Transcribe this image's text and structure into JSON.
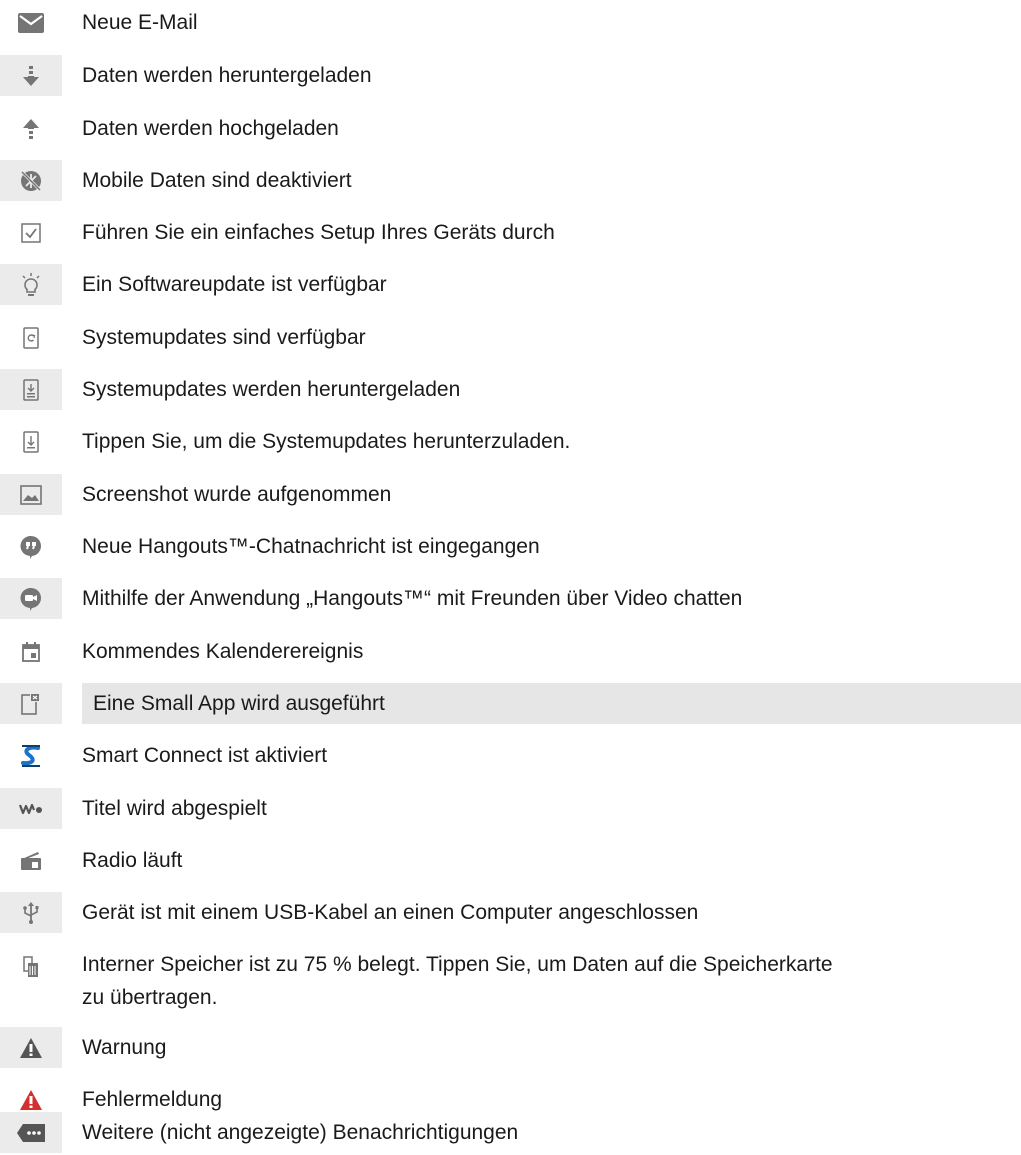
{
  "items": [
    {
      "icon": "envelope-icon",
      "label": "Neue E-Mail"
    },
    {
      "icon": "download-arrow-icon",
      "label": "Daten werden heruntergeladen"
    },
    {
      "icon": "upload-arrow-icon",
      "label": "Daten werden hochgeladen"
    },
    {
      "icon": "mobile-data-disabled-icon",
      "label": "Mobile Daten sind deaktiviert"
    },
    {
      "icon": "checkbox-checked-icon",
      "label": "Führen Sie ein einfaches Setup Ihres Geräts durch"
    },
    {
      "icon": "lightbulb-icon",
      "label": "Ein Softwareupdate ist verfügbar"
    },
    {
      "icon": "system-update-icon",
      "label": "Systemupdates sind verfügbar"
    },
    {
      "icon": "system-update-download-icon",
      "label": "Systemupdates werden heruntergeladen"
    },
    {
      "icon": "tap-download-icon",
      "label": "Tippen Sie, um die Systemupdates herunterzuladen."
    },
    {
      "icon": "screenshot-image-icon",
      "label": "Screenshot wurde aufgenommen"
    },
    {
      "icon": "hangouts-quote-icon",
      "label": "Neue Hangouts™-Chatnachricht ist eingegangen"
    },
    {
      "icon": "hangouts-video-icon",
      "label": "Mithilfe der Anwendung „Hangouts™“ mit Freunden über Video chatten"
    },
    {
      "icon": "calendar-icon",
      "label": "Kommendes Kalenderereignis"
    },
    {
      "icon": "small-app-icon",
      "label": "Eine Small App wird ausgeführt"
    },
    {
      "icon": "smart-connect-icon",
      "label": "Smart Connect ist aktiviert"
    },
    {
      "icon": "walkman-icon",
      "label": "Titel wird abgespielt"
    },
    {
      "icon": "radio-icon",
      "label": "Radio läuft"
    },
    {
      "icon": "usb-icon",
      "label": "Gerät ist mit einem USB-Kabel an einen Computer angeschlossen"
    },
    {
      "icon": "storage-card-icon",
      "label": "Interner Speicher ist zu 75 % belegt. Tippen Sie, um Daten auf die Speicherkarte",
      "label2": "zu übertragen."
    },
    {
      "icon": "warning-icon",
      "label": "Warnung"
    },
    {
      "icon": "error-icon",
      "label": "Fehlermeldung"
    },
    {
      "icon": "more-notifications-icon",
      "label": "Weitere (nicht angezeigte) Benachrichtigungen"
    }
  ],
  "colors": {
    "icon_gray": "#757575",
    "stripe": "#ebebeb",
    "error_red": "#d32f2f",
    "smart_connect_blue": "#1a73c8"
  }
}
